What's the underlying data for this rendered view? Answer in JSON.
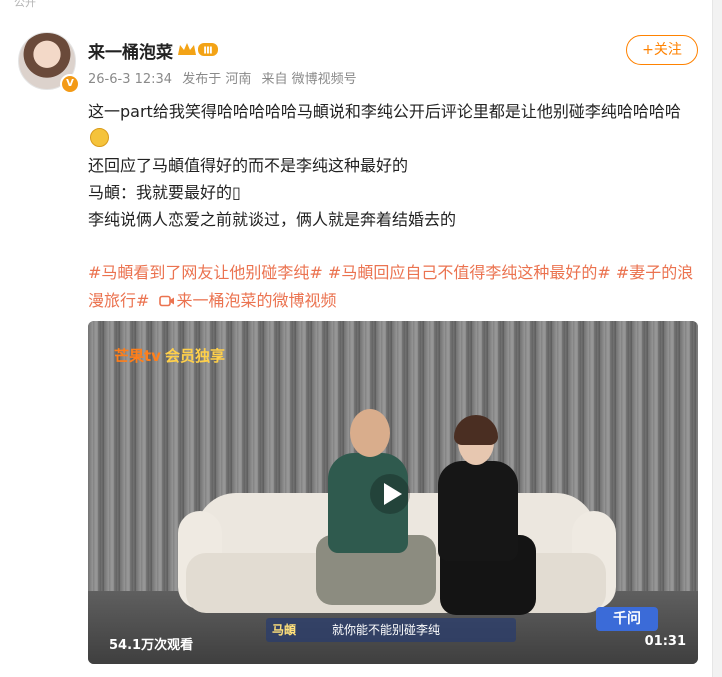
{
  "header_strip": "公开",
  "user": {
    "name": "来一桶泡菜",
    "level_badge": "Ⅲ",
    "avatar_badge": "V"
  },
  "meta": {
    "time": "26-6-3 12:34",
    "location": "发布于 河南",
    "source": "来自 微博视频号"
  },
  "follow_label": "+关注",
  "post": {
    "lines": [
      "这一part给我笑得哈哈哈哈哈马頔说和李纯公开后评论里都是让他别碰李纯哈哈哈哈",
      "还回应了马頔值得好的而不是李纯这种最好的",
      "马頔：我就要最好的",
      "李纯说俩人恋爱之前就谈过，俩人就是奔着结婚去的"
    ],
    "tags": [
      "#马頔看到了网友让他别碰李纯#",
      "#马頔回应自己不值得李纯这种最好的#",
      "#妻子的浪漫旅行#"
    ],
    "video_link": "来一桶泡菜的微博视频"
  },
  "video": {
    "logo": "芒果tv",
    "logo_sub": "会员独享",
    "subtitle_name": "马頔",
    "subtitle": "就你能不能别碰李纯",
    "watermark": "千问",
    "views": "54.1万次观看",
    "duration": "01:31"
  }
}
